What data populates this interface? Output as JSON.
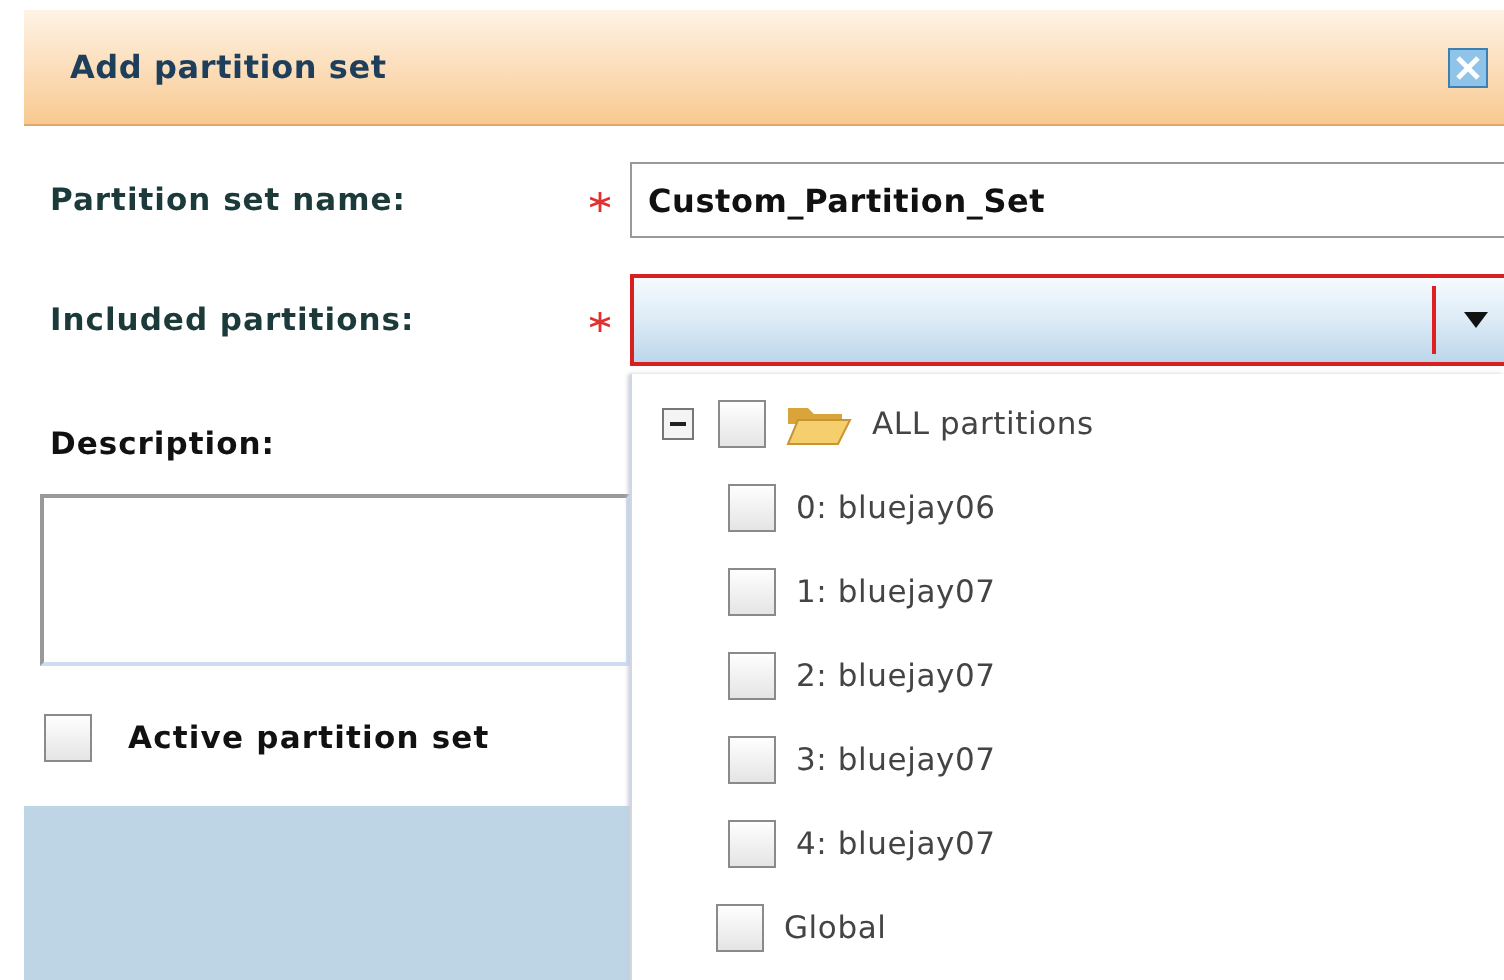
{
  "dialog": {
    "title": "Add partition set",
    "fields": [
      {
        "kind": "text",
        "label": "Partition set name:",
        "required": true,
        "value": "Custom_Partition_Set"
      },
      {
        "kind": "combo",
        "label": "Included partitions:",
        "required": true,
        "invalid": true
      }
    ],
    "description": {
      "label": "Description:"
    },
    "active": {
      "label": "Active partition set",
      "checked": false
    },
    "dropdown": {
      "items": [
        {
          "label": "ALL partitions",
          "checked": false,
          "expanded": true,
          "children": [
            {
              "label": "0: bluejay06",
              "checked": false
            },
            {
              "label": "1: bluejay07",
              "checked": false
            },
            {
              "label": "2: bluejay07",
              "checked": false
            },
            {
              "label": "3: bluejay07",
              "checked": false
            },
            {
              "label": "4: bluejay07",
              "checked": false
            }
          ]
        },
        {
          "label": "Global",
          "checked": false
        }
      ]
    }
  }
}
